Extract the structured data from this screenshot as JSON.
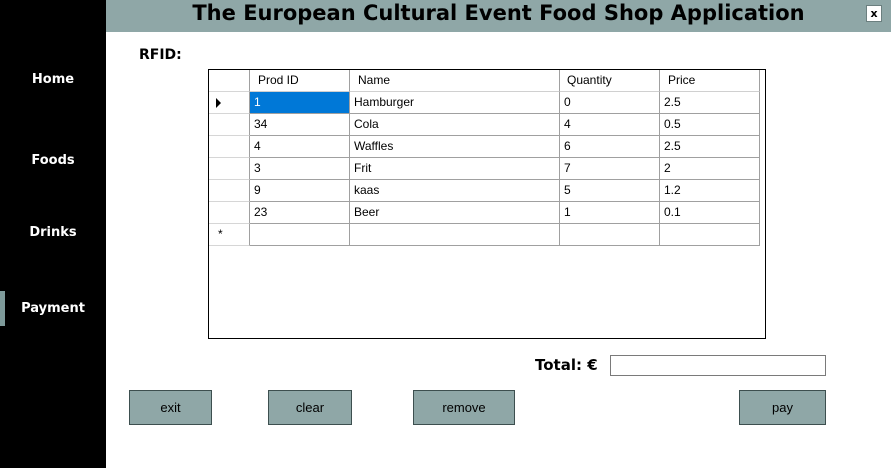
{
  "app": {
    "title": "The European Cultural Event Food Shop Application",
    "close_label": "x"
  },
  "sidebar": {
    "items": [
      {
        "label": "Home"
      },
      {
        "label": "Foods"
      },
      {
        "label": "Drinks"
      },
      {
        "label": "Payment"
      }
    ],
    "active": "Payment"
  },
  "rfid": {
    "label": "RFID:"
  },
  "grid": {
    "columns": [
      "Prod ID",
      "Name",
      "Quantity",
      "Price"
    ],
    "rows": [
      [
        "1",
        "Hamburger",
        "0",
        "2.5"
      ],
      [
        "34",
        "Cola",
        "4",
        "0.5"
      ],
      [
        "4",
        "Waffles",
        "6",
        "2.5"
      ],
      [
        "3",
        "Frit",
        "7",
        "2"
      ],
      [
        "9",
        "kaas",
        "5",
        "1.2"
      ],
      [
        "23",
        "Beer",
        "1",
        "0.1"
      ]
    ],
    "new_row_marker": "*"
  },
  "total": {
    "label": "Total: €",
    "value": ""
  },
  "buttons": {
    "exit": "exit",
    "clear": "clear",
    "remove": "remove",
    "pay": "pay"
  },
  "colors": {
    "accent": "#8fa7a7",
    "sidebar": "#000000",
    "selection": "#0078d7"
  }
}
